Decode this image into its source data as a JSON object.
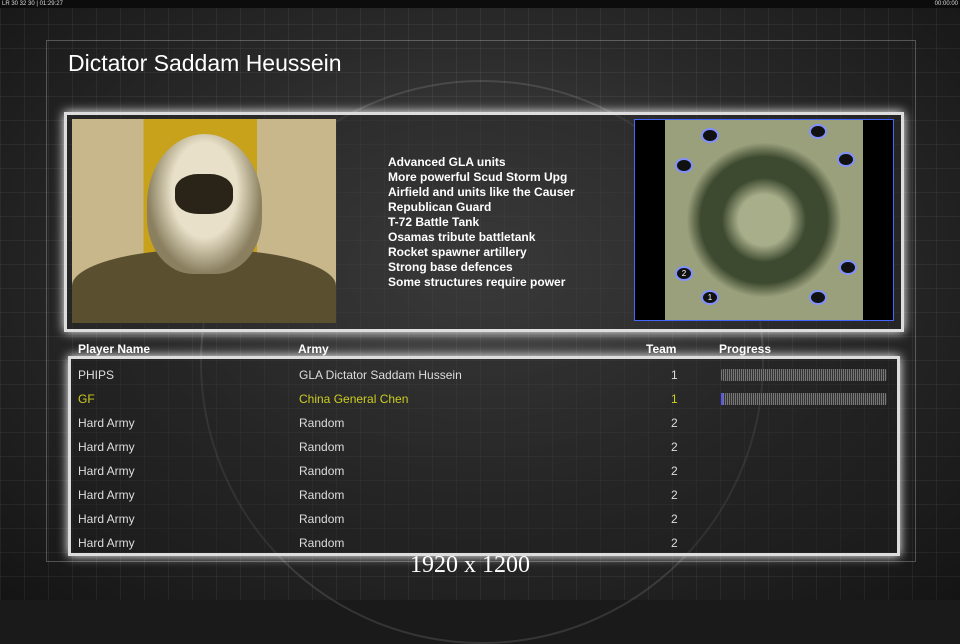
{
  "topbar": {
    "left": "LR 30 32 30 | 01:29:27",
    "right": "00:00:00"
  },
  "title": "Dictator Saddam Heussein",
  "features": [
    "Advanced GLA units",
    "More powerful Scud Storm Upg",
    "Airfield and units like the Causer",
    "Republican Guard",
    "T-72 Battle Tank",
    "Osamas tribute battletank",
    "Rocket spawner artillery",
    "Strong base defences",
    "Some structures require power"
  ],
  "map": {
    "start_labels": [
      "1",
      "2"
    ]
  },
  "headers": {
    "player": "Player Name",
    "army": "Army",
    "team": "Team",
    "progress": "Progress"
  },
  "players": [
    {
      "name": "PHIPS",
      "army": "GLA Dictator Saddam Hussein",
      "team": "1",
      "progress": 0
    },
    {
      "name": "GF",
      "army": "China General Chen",
      "team": "1",
      "progress": 0.01
    },
    {
      "name": "Hard Army",
      "army": "Random",
      "team": "2"
    },
    {
      "name": "Hard Army",
      "army": "Random",
      "team": "2"
    },
    {
      "name": "Hard Army",
      "army": "Random",
      "team": "2"
    },
    {
      "name": "Hard Army",
      "army": "Random",
      "team": "2"
    },
    {
      "name": "Hard Army",
      "army": "Random",
      "team": "2"
    },
    {
      "name": "Hard Army",
      "army": "Random",
      "team": "2"
    }
  ],
  "resolution": "1920 x 1200"
}
